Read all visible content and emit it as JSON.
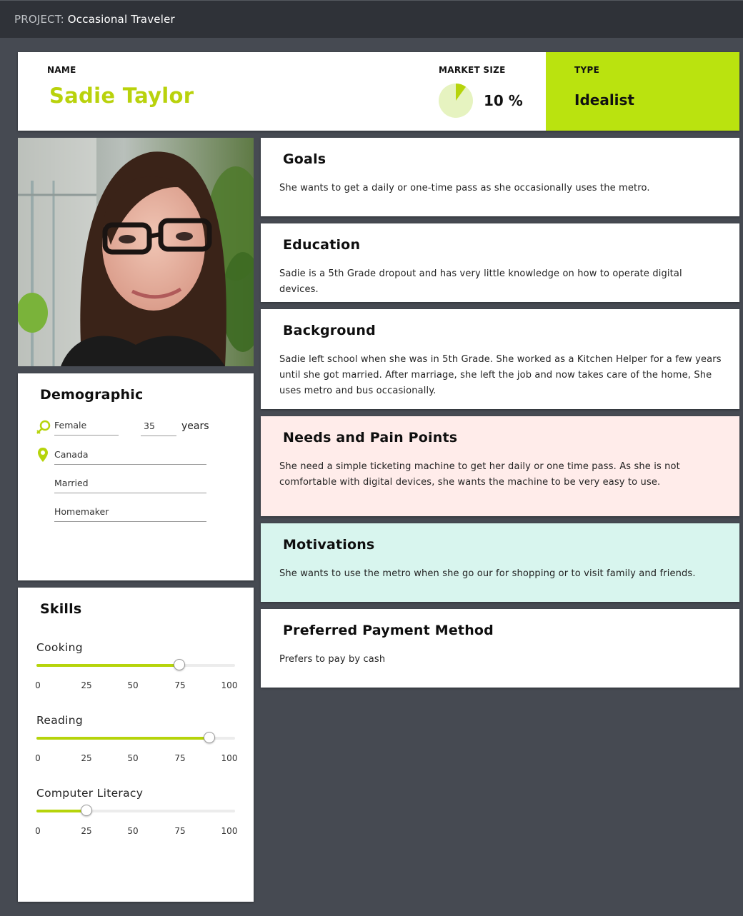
{
  "topbar": {
    "prefix": "PROJECT:",
    "project": "Occasional Traveler"
  },
  "header": {
    "name_label": "NAME",
    "name": "Sadie Taylor",
    "market_label": "MARKET SIZE",
    "market_value": "10 %",
    "market_fraction": 0.1,
    "type_label": "TYPE",
    "type_value": "Idealist"
  },
  "demographic": {
    "title": "Demographic",
    "gender": "Female",
    "age": "35",
    "age_unit": "years",
    "location": "Canada",
    "status": "Married",
    "occupation": "Homemaker"
  },
  "skills": {
    "title": "Skills",
    "ticks": [
      "0",
      "25",
      "50",
      "75",
      "100"
    ],
    "items": [
      {
        "label": "Cooking",
        "value": 72
      },
      {
        "label": "Reading",
        "value": 87
      },
      {
        "label": "Computer Literacy",
        "value": 25
      }
    ]
  },
  "cards": {
    "goals": {
      "title": "Goals",
      "text": "She wants to get a daily or one-time pass as she occasionally uses the metro."
    },
    "education": {
      "title": "Education",
      "text": "Sadie is a 5th Grade dropout and has very little knowledge on how to operate digital devices."
    },
    "background": {
      "title": "Background",
      "text": "Sadie left school when she was in 5th Grade. She worked as a Kitchen Helper for a few years until she got married. After marriage, she left the job and now takes care of the home, She uses metro and bus occasionally."
    },
    "needs": {
      "title": "Needs and Pain Points",
      "text": "She need a simple ticketing machine to get her daily or one time pass. As she is not comfortable with digital devices, she wants the machine to be very easy to use."
    },
    "motivations": {
      "title": "Motivations",
      "text": "She wants to use the metro when she go our for shopping or to visit family and friends."
    },
    "payment": {
      "title": "Preferred Payment Method",
      "text": "Prefers to pay by cash"
    }
  },
  "colors": {
    "accent": "#bae30f",
    "name": "#b9d20c",
    "needs_bg": "#ffecea",
    "motivations_bg": "#d8f5ee",
    "page_bg": "#464a52",
    "topbar_bg": "#2f3238"
  },
  "icons": {
    "gender": "female-male-icon",
    "location": "map-pin-icon"
  },
  "photo": {
    "alt": "Portrait photo"
  }
}
